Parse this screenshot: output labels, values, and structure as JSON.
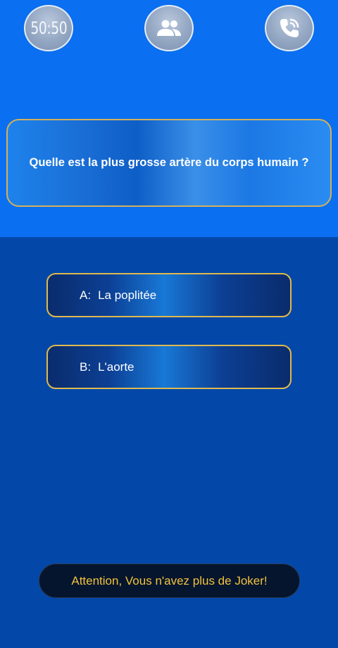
{
  "jokers": {
    "fifty_fifty_label": "50:50",
    "audience_icon": "people-group-icon",
    "phone_icon": "phone-ringing-icon"
  },
  "question": {
    "text": "Quelle est la plus grosse artère du corps humain ?"
  },
  "answers": [
    {
      "letter": "A:",
      "text": "La poplitée"
    },
    {
      "letter": "B:",
      "text": "L'aorte"
    }
  ],
  "notice": {
    "text": "Attention, Vous n'avez plus de Joker!"
  },
  "colors": {
    "top_background": "#0a6ff0",
    "bottom_background": "#0348a8",
    "border_gold": "#d4b15a",
    "warning_text": "#f2c23c"
  }
}
